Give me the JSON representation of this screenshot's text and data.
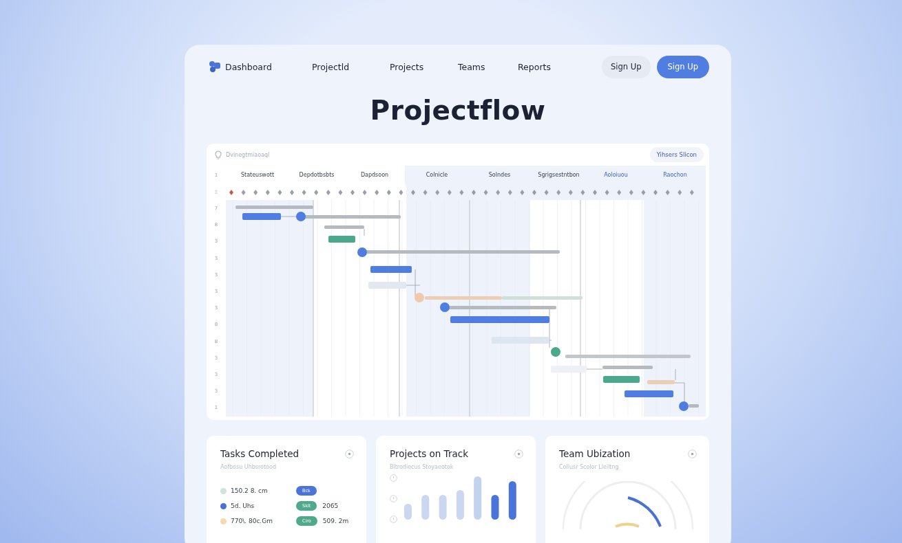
{
  "nav": {
    "logo": "Dashboard",
    "links": [
      "Projectld",
      "Projects",
      "Teams",
      "Reports"
    ],
    "buttons": [
      {
        "label": "Sign Up",
        "kind": "secondary"
      },
      {
        "label": "Sign Up",
        "kind": "primary"
      }
    ]
  },
  "title": "Projectflow",
  "gantt": {
    "search": {
      "placeholder": "Dvinegtmiaoaql"
    },
    "action": "Yihsers Slicon",
    "columns": [
      {
        "label": "Stateuswott",
        "highlighted": false
      },
      {
        "label": "Depdotbsbts",
        "highlighted": false
      },
      {
        "label": "Dapdsoon",
        "highlighted": false
      },
      {
        "label": "Colnicle",
        "highlighted": false
      },
      {
        "label": "Solndes",
        "highlighted": false
      },
      {
        "label": "Sgrigsestntbon",
        "highlighted": false
      },
      {
        "label": "Aoloiuou",
        "highlighted": true
      },
      {
        "label": "Raochon",
        "highlighted": true
      }
    ],
    "header_label": "1",
    "marker_label": "Ξ",
    "row_labels": [
      "7",
      "8",
      "3",
      "3",
      "3",
      "3",
      "3",
      "8",
      "8",
      "3",
      "3",
      "3",
      "1"
    ]
  },
  "cards": [
    {
      "title": "Tasks Completed",
      "subtitle": "Aofbosu Uhbsrotood",
      "kind": "legend",
      "rows": [
        {
          "color": "#cfe4dc",
          "value": "150.2 8. cm",
          "badge": {
            "label": "Bck",
            "color": "#4a74d9"
          }
        },
        {
          "color": "#4a6fd6",
          "value": "5d. Uhs",
          "badge": {
            "label": "Sklt",
            "color": "#4faa8c"
          },
          "extra": "2065"
        },
        {
          "color": "#f5d9b0",
          "value": "770\\. 80c.Gm",
          "badge": {
            "label": "Ciro",
            "color": "#4faa8c"
          },
          "extra": "509. 2m"
        }
      ]
    },
    {
      "title": "Projects on Track",
      "subtitle": "Bltrodiecus Stoyaeotok",
      "kind": "bars"
    },
    {
      "title": "Team Ubization",
      "subtitle": "Collusr Scolor Lleiltng",
      "kind": "gauge"
    }
  ]
}
